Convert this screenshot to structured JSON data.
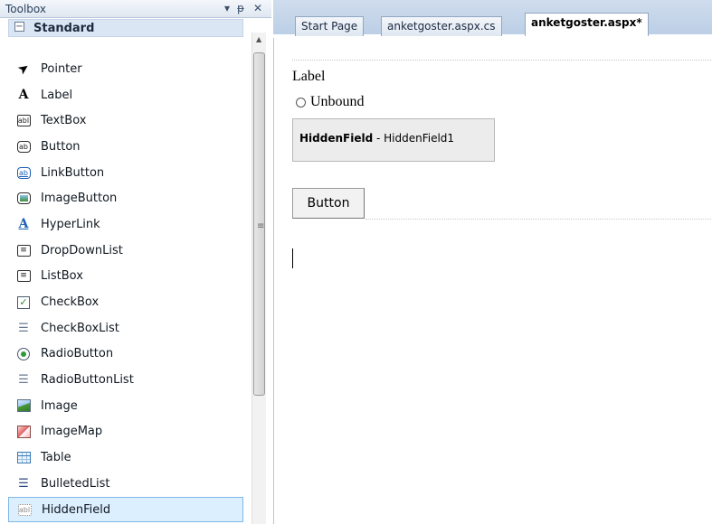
{
  "toolbox": {
    "title": "Toolbox",
    "dropdown_icon": "dropdown-arrow-icon",
    "pin_icon": "pin-icon",
    "close_icon": "close-icon",
    "category": {
      "label": "Standard",
      "expanded": true,
      "expander_glyph": "−"
    },
    "items": [
      {
        "label": "Pointer",
        "icon": "pointer-icon",
        "glyph": "➤"
      },
      {
        "label": "Label",
        "icon": "label-icon",
        "glyph": "A"
      },
      {
        "label": "TextBox",
        "icon": "textbox-icon",
        "glyph": "abl"
      },
      {
        "label": "Button",
        "icon": "button-icon",
        "glyph": "ab"
      },
      {
        "label": "LinkButton",
        "icon": "linkbutton-icon",
        "glyph": "ab"
      },
      {
        "label": "ImageButton",
        "icon": "imagebutton-icon",
        "glyph": ""
      },
      {
        "label": "HyperLink",
        "icon": "hyperlink-icon",
        "glyph": "A"
      },
      {
        "label": "DropDownList",
        "icon": "dropdownlist-icon",
        "glyph": "≡"
      },
      {
        "label": "ListBox",
        "icon": "listbox-icon",
        "glyph": "≡"
      },
      {
        "label": "CheckBox",
        "icon": "checkbox-icon",
        "glyph": "✓"
      },
      {
        "label": "CheckBoxList",
        "icon": "checkboxlist-icon",
        "glyph": "☰"
      },
      {
        "label": "RadioButton",
        "icon": "radiobutton-icon",
        "glyph": ""
      },
      {
        "label": "RadioButtonList",
        "icon": "radiobuttonlist-icon",
        "glyph": "☰"
      },
      {
        "label": "Image",
        "icon": "image-icon",
        "glyph": ""
      },
      {
        "label": "ImageMap",
        "icon": "imagemap-icon",
        "glyph": ""
      },
      {
        "label": "Table",
        "icon": "table-icon",
        "glyph": ""
      },
      {
        "label": "BulletedList",
        "icon": "bulletedlist-icon",
        "glyph": "☰"
      },
      {
        "label": "HiddenField",
        "icon": "hiddenfield-icon",
        "glyph": "abl",
        "selected": true
      }
    ]
  },
  "editor": {
    "tabs": [
      {
        "label": "Start Page",
        "active": false
      },
      {
        "label": "anketgoster.aspx.cs",
        "active": false
      },
      {
        "label": "anketgoster.aspx*",
        "active": true
      }
    ],
    "design": {
      "label_text": "Label",
      "radio_text": "Unbound",
      "hidden_field_type": "HiddenField",
      "hidden_field_sep": " - ",
      "hidden_field_id": "HiddenField1",
      "button_text": "Button"
    }
  },
  "colors": {
    "toolbox_bg": "#eef3fa",
    "tab_strip": "#bccfe6",
    "selected_item": "#dcefff",
    "selected_border": "#7fb8e8"
  }
}
